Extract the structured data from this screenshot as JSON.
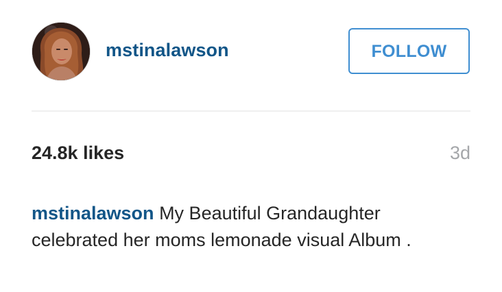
{
  "post": {
    "username": "mstinalawson",
    "follow_label": "FOLLOW",
    "likes": "24.8k likes",
    "time_ago": "3d",
    "caption": {
      "username": "mstinalawson",
      "text": "My Beautiful Grandaughter celebrated her moms lemonade visual Album ."
    }
  },
  "colors": {
    "username": "#125688",
    "follow_border": "#3f8ed1",
    "divider": "#efefef",
    "time": "#a5a7aa",
    "text": "#262626"
  }
}
